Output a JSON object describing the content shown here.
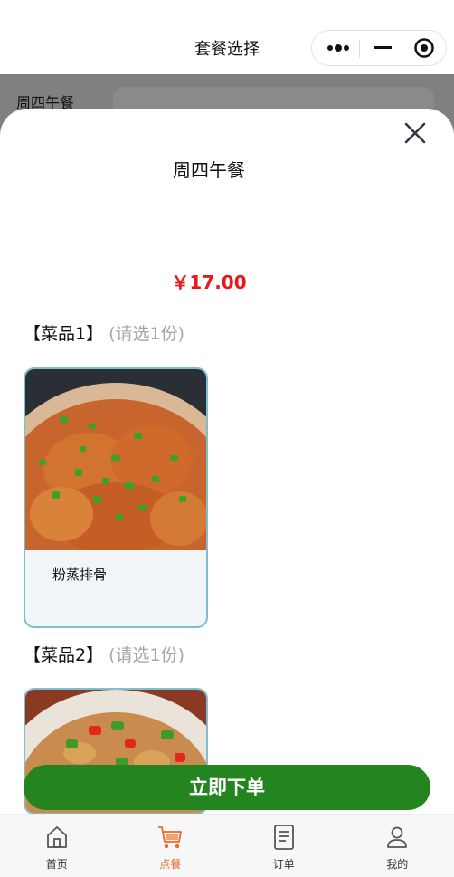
{
  "header": {
    "title": "套餐选择",
    "capsule": {
      "more_icon": "more-dots-icon",
      "minimize_icon": "minimize-icon",
      "close_icon": "target-circle-icon"
    }
  },
  "background": {
    "tab_label": "周四午餐"
  },
  "modal": {
    "close_icon": "close-x-icon",
    "package_name": "周四午餐",
    "price": "￥17.00",
    "sections": [
      {
        "title": "【菜品1】",
        "hint": "(请选1份)",
        "dishes": [
          {
            "name": "粉蒸排骨"
          }
        ]
      },
      {
        "title": "【菜品2】",
        "hint": "(请选1份)",
        "dishes": [
          {
            "name": ""
          }
        ]
      }
    ]
  },
  "order_button": {
    "label": "立即下单"
  },
  "tabbar": {
    "items": [
      {
        "label": "首页",
        "icon": "home-icon",
        "active": false
      },
      {
        "label": "点餐",
        "icon": "cart-icon",
        "active": true
      },
      {
        "label": "订单",
        "icon": "document-icon",
        "active": false
      },
      {
        "label": "我的",
        "icon": "user-icon",
        "active": false
      }
    ]
  },
  "colors": {
    "accent": "#e86a28",
    "price": "#e31b1b",
    "button": "#248520",
    "card_border": "#7cbfd0"
  }
}
